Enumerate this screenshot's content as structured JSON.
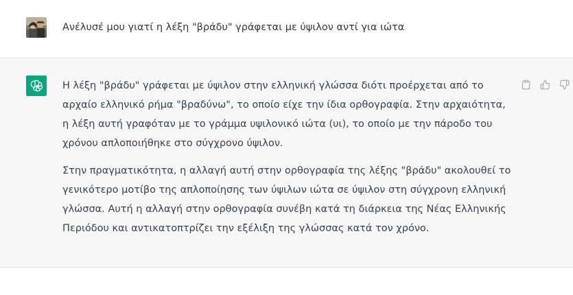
{
  "user_message": {
    "text": "Ανέλυσέ μου γιατί η λέξη \"βράδυ\" γράφεται με ύψιλον αντί για ιώτα"
  },
  "assistant_message": {
    "paragraphs": [
      "Η λέξη \"βράδυ\" γράφεται με ύψιλον στην ελληνική γλώσσα διότι προέρχεται από το αρχαίο ελληνικό ρήμα \"βραδύνω\", το οποίο είχε την ίδια ορθογραφία. Στην αρχαιότητα, η λέξη αυτή γραφόταν με το γράμμα υψιλονικό ιώτα (υι), το οποίο με την πάροδο του χρόνου απλοποιήθηκε στο σύγχρονο ύψιλον.",
      "Στην πραγματικότητα, η αλλαγή αυτή στην ορθογραφία της λέξης \"βράδυ\" ακολουθεί το γενικότερο μοτίβο της απλοποίησης των ύψιλων ιώτα σε ύψιλον στη σύγχρονη ελληνική γλώσσα. Αυτή η αλλαγή στην ορθογραφία συνέβη κατά τη διάρκεια της Νέας Ελληνικής Περιόδου και αντικατοπτρίζει την εξέλιξη της γλώσσας κατά τον χρόνο."
    ]
  },
  "icons": {
    "user_avatar": "user-photo-avatar",
    "assistant_avatar": "openai-logo-icon",
    "copy": "clipboard-icon",
    "like": "thumbs-up-icon",
    "dislike": "thumbs-down-icon"
  },
  "colors": {
    "assistant_bg": "#f7f7f8",
    "avatar_green": "#10a37f",
    "text": "#374151",
    "icon_gray": "#acacbe"
  }
}
